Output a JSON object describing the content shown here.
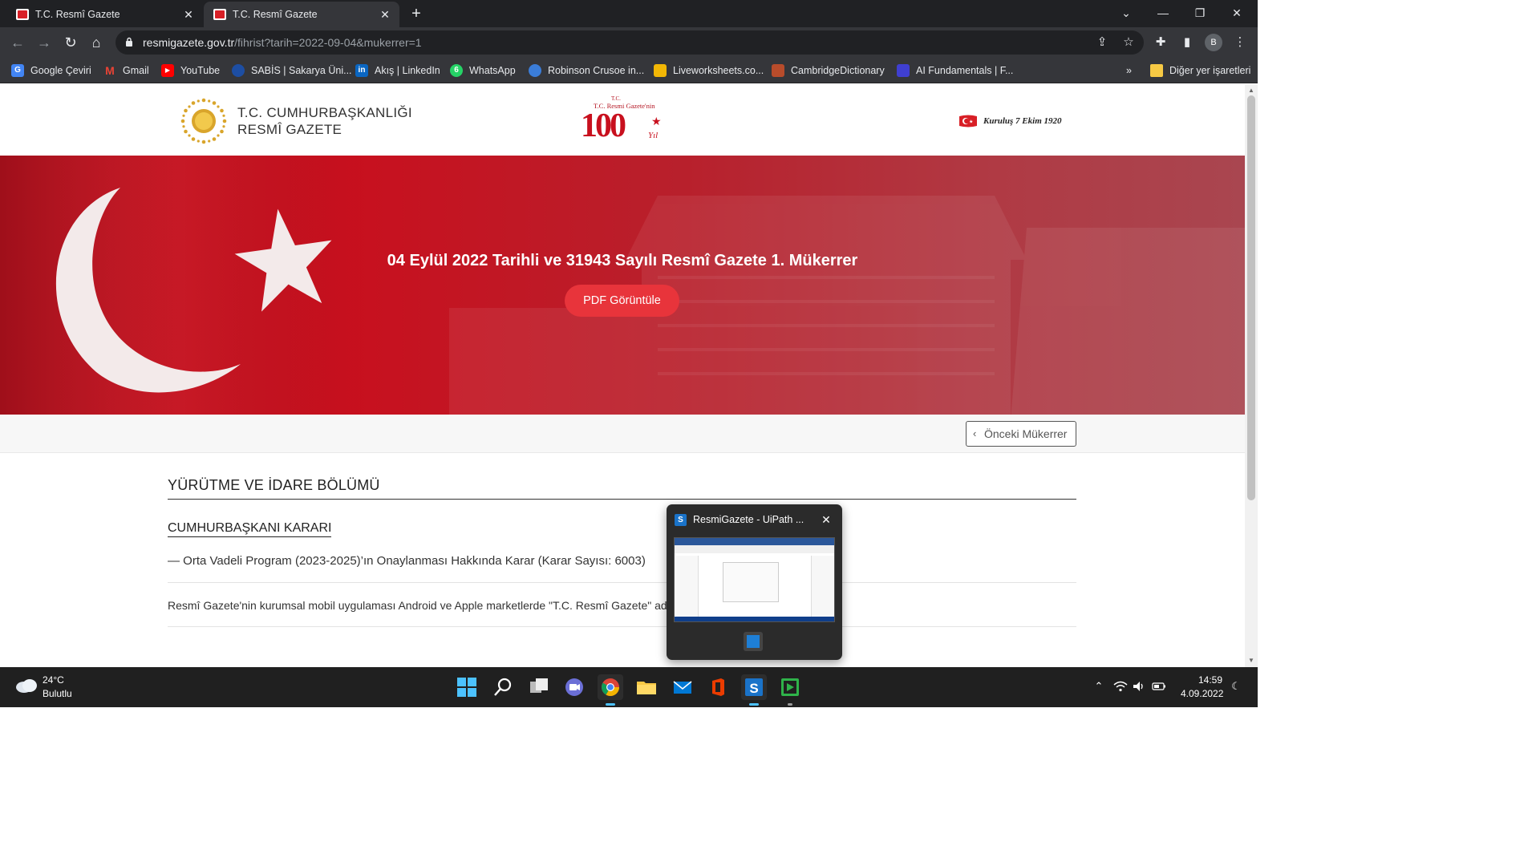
{
  "browser": {
    "tabs": [
      {
        "title": "T.C. Resmî Gazete",
        "active": false
      },
      {
        "title": "T.C. Resmî Gazete",
        "active": true
      }
    ],
    "url_host": "resmigazete.gov.tr",
    "url_path": "/fihrist?tarih=2022-09-04&mukerrer=1",
    "profile_initial": "B",
    "bookmarks": [
      {
        "label": "Google Çeviri",
        "icon": "google-translate-icon",
        "color": "#4285f4"
      },
      {
        "label": "Gmail",
        "icon": "gmail-icon",
        "color": "#ea4335"
      },
      {
        "label": "YouTube",
        "icon": "youtube-icon",
        "color": "#ff0000"
      },
      {
        "label": "SABİS | Sakarya Üni...",
        "icon": "sabis-icon",
        "color": "#1d4ea3"
      },
      {
        "label": "Akış | LinkedIn",
        "icon": "linkedin-icon",
        "color": "#0a66c2"
      },
      {
        "label": "WhatsApp",
        "icon": "whatsapp-icon",
        "color": "#25d366"
      },
      {
        "label": "Robinson Crusoe in...",
        "icon": "robinson-icon",
        "color": "#3b7dd8"
      },
      {
        "label": "Liveworksheets.co...",
        "icon": "liveworksheets-icon",
        "color": "#f2b705"
      },
      {
        "label": "CambridgeDictionary",
        "icon": "cambridge-icon",
        "color": "#b84c2b"
      },
      {
        "label": "AI Fundamentals | F...",
        "icon": "ai-fundamentals-icon",
        "color": "#3f3fd1"
      }
    ],
    "overflow_label": "»",
    "other_bookmarks": "Diğer yer işaretleri"
  },
  "site": {
    "brand_line1": "T.C. CUMHURBAŞKANLIĞI",
    "brand_line2": "RESMÎ GAZETE",
    "anniversary_caption": "T.C. Resmi Gazete'nin",
    "anniversary_number": "100",
    "anniversary_suffix": "Yıl",
    "founded": "Kuruluş 7 Ekim 1920"
  },
  "hero": {
    "title": "04 Eylül 2022 Tarihli ve 31943 Sayılı Resmî Gazete 1. Mükerrer",
    "pdf_button": "PDF Görüntüle"
  },
  "subbar": {
    "prev_button": "Önceki Mükerrer"
  },
  "content": {
    "section_title": "YÜRÜTME VE İDARE BÖLÜMÜ",
    "sub_title": "CUMHURBAŞKANI KARARI",
    "item": "— Orta Vadeli Program (2023-2025)’ın Onaylanması Hakkında Karar (Karar Sayısı: 6003)",
    "info": "Resmî Gazete'nin kurumsal mobil uygulaması Android ve Apple marketlerde \"T.C. Resmî Gazete\" adı"
  },
  "thumbnail_preview": {
    "title": "ResmiGazete - UiPath ..."
  },
  "taskbar": {
    "temperature": "24°C",
    "weather": "Bulutlu",
    "time": "14:59",
    "date": "4.09.2022"
  },
  "colors": {
    "hero_red": "#c8101e",
    "button_red": "#e8343b",
    "chrome_dark": "#202124",
    "chrome_toolbar": "#35363a",
    "taskbar": "#202020"
  }
}
